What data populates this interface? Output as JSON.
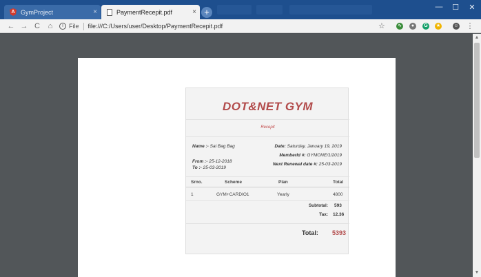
{
  "browser": {
    "tabs": [
      {
        "label": "GymProject",
        "icon": "angular-icon",
        "close": "×"
      },
      {
        "label": "PaymentRecepit.pdf",
        "icon": "page-icon",
        "close": "×"
      }
    ],
    "new_tab": "+",
    "window_controls": {
      "minimize": "—",
      "maximize": "☐",
      "close": "✕"
    },
    "nav": {
      "back": "←",
      "forward": "→",
      "reload": "C",
      "home": "⌂"
    },
    "address": {
      "scheme": "File",
      "info": "i",
      "url": "file:///C:/Users/user/Desktop/PaymentRecepit.pdf"
    },
    "bookmark": "☆",
    "extensions": [
      {
        "name": "ext-green-icon",
        "color": "#3b8d3b",
        "glyph": "∿"
      },
      {
        "name": "ext-gray-icon",
        "color": "#777777",
        "glyph": "●"
      },
      {
        "name": "ext-grammarly-icon",
        "color": "#15a06a",
        "glyph": "G"
      },
      {
        "name": "ext-star-icon",
        "color": "#f0b400",
        "glyph": "★"
      },
      {
        "name": "profile-icon",
        "color": "#555555",
        "glyph": "☺"
      }
    ],
    "menu": "⋮"
  },
  "receipt": {
    "gym_name": "DOT&NET GYM",
    "label": "Recepit",
    "name_label": "Name :-",
    "name_value": "Sai Bag Bag",
    "date_label": "Date:",
    "date_value": "Saturday, January 19, 2019",
    "member_label": "MemberId #:",
    "member_value": "GYMONE/1/2019",
    "from_label": "From :-",
    "from_value": "25-12-2018",
    "to_label": "To :-",
    "to_value": "25-03-2019",
    "renewal_label": "Next Renewal date #:",
    "renewal_value": "25-03-2019",
    "table": {
      "headers": [
        "Srno.",
        "Scheme",
        "Plan",
        "Total"
      ],
      "rows": [
        [
          "1",
          "GYM+CARDIO1",
          "Yearly",
          "4800"
        ]
      ]
    },
    "subtotal_label": "Subtotal:",
    "subtotal_value": "593",
    "tax_label": "Tax:",
    "tax_value": "12.36",
    "total_label": "Total:",
    "total_value": "5393"
  },
  "colors": {
    "brand_red": "#b24b4b",
    "titlebar": "#1e4f8e",
    "viewer_bg": "#525659"
  }
}
